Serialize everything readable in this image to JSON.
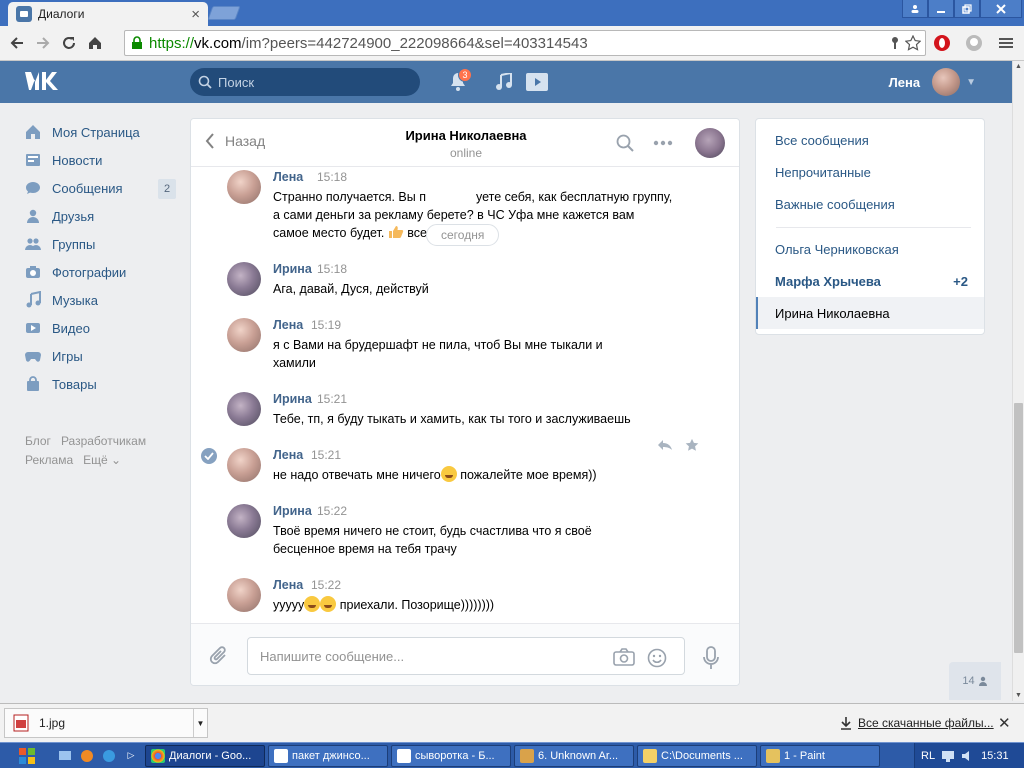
{
  "browser": {
    "tab_title": "Диалоги",
    "url_scheme": "https://",
    "url_host": "vk.com",
    "url_path": "/im?peers=442724900_222098664&sel=403314543"
  },
  "vk_header": {
    "search_placeholder": "Поиск",
    "notifications_count": "3",
    "user_name": "Лена"
  },
  "left_nav": {
    "items": [
      {
        "label": "Моя Страница",
        "icon": "home-icon"
      },
      {
        "label": "Новости",
        "icon": "news-icon"
      },
      {
        "label": "Сообщения",
        "icon": "messages-icon",
        "count": "2"
      },
      {
        "label": "Друзья",
        "icon": "friends-icon"
      },
      {
        "label": "Группы",
        "icon": "groups-icon"
      },
      {
        "label": "Фотографии",
        "icon": "camera-icon"
      },
      {
        "label": "Музыка",
        "icon": "music-icon"
      },
      {
        "label": "Видео",
        "icon": "video-icon"
      },
      {
        "label": "Игры",
        "icon": "gamepad-icon"
      },
      {
        "label": "Товары",
        "icon": "bag-icon"
      }
    ],
    "footer": [
      "Блог",
      "Разработчикам",
      "Реклама",
      "Ещё ⌄"
    ]
  },
  "chat": {
    "back_label": "Назад",
    "peer_name": "Ирина Николаевна",
    "peer_status": "online",
    "date_divider": "сегодня",
    "messages": [
      {
        "author": "Лена",
        "time": "15:18",
        "text": "Странно получается. Вы п... ...уете себя, как бесплатную группу, а сами деньги за рекламу берете? в ЧС Уфа мне кажется вам самое место будет. 👍 всего доброго"
      },
      {
        "author": "Ирина",
        "time": "15:18",
        "text": "Ага, давай, Дуся, действуй"
      },
      {
        "author": "Лена",
        "time": "15:19",
        "text": "я с Вами на брудершафт не пила, чтоб Вы мне тыкали и хамили"
      },
      {
        "author": "Ирина",
        "time": "15:21",
        "text": "Тебе, тп, я буду тыкать и хамить, как ты того и заслуживаешь"
      },
      {
        "author": "Лена",
        "time": "15:21",
        "text_a": "не надо отвечать мне ничего",
        "text_b": " пожалейте мое время))"
      },
      {
        "author": "Ирина",
        "time": "15:22",
        "text": "Твоё время ничего не стоит, будь счастлива что я своё бесценное время на тебя трачу"
      },
      {
        "author": "Лена",
        "time": "15:22",
        "text_a": "ууууу",
        "text_b": " приехали. Позорище))))))))"
      }
    ],
    "msg1_a": "Странно получается. Вы п",
    "msg1_b": "уете себя, как бесплатную группу, а сами деньги за рекламу берете? в ЧС Уфа мне кажется вам самое место будет.",
    "msg1_c": " всего доброго",
    "composer_placeholder": "Напишите сообщение..."
  },
  "right_panel": {
    "filters": [
      "Все сообщения",
      "Непрочитанные",
      "Важные сообщения"
    ],
    "dialogs": [
      {
        "name": "Ольга Черниковская",
        "count": ""
      },
      {
        "name": "Марфа Хрычева",
        "count": "+2"
      },
      {
        "name": "Ирина Николаевна",
        "count": ""
      }
    ]
  },
  "friends_online": "14",
  "downloads": {
    "file_name": "1.jpg",
    "all_label": "Все скачанные файлы..."
  },
  "taskbar": {
    "items": [
      "Диалоги - Goo...",
      "пакет джинсо...",
      "сыворотка - Б...",
      "6. Unknown Ar...",
      "C:\\Documents ...",
      "1 - Paint"
    ],
    "lang": "RL",
    "clock": "15:31"
  },
  "colors": {
    "vk_blue": "#4a76a8",
    "link": "#2a5885",
    "author": "#42648b",
    "chrome_frame": "#3d6fbe"
  }
}
